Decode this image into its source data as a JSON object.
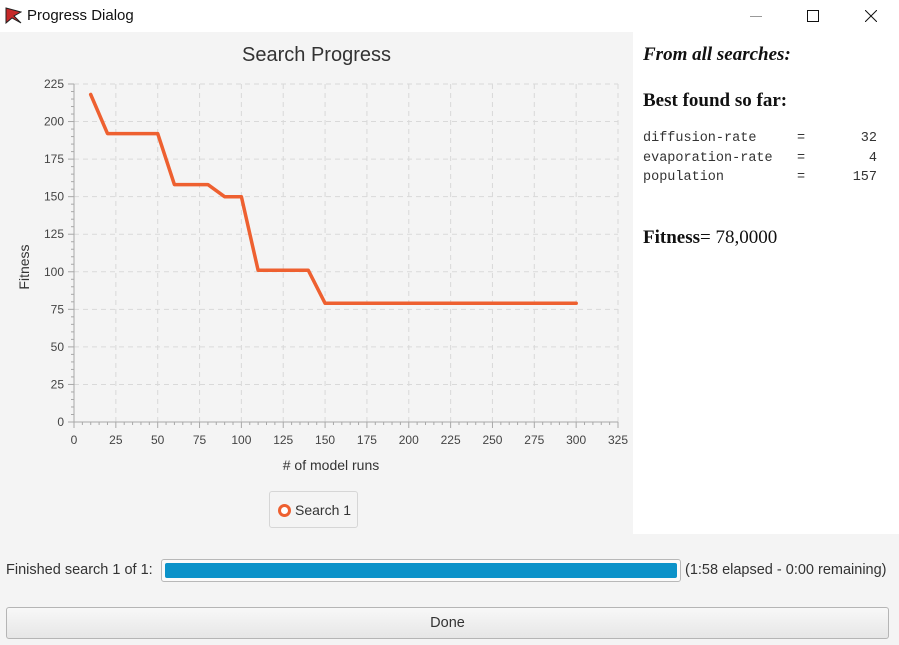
{
  "window": {
    "title": "Progress Dialog"
  },
  "chart": {
    "title": "Search Progress",
    "legend_label": "Search 1"
  },
  "chart_data": {
    "type": "line",
    "title": "Search Progress",
    "xlabel": "# of model runs",
    "ylabel": "Fitness",
    "xlim": [
      0,
      325
    ],
    "ylim": [
      0,
      225
    ],
    "xticks": [
      0,
      25,
      50,
      75,
      100,
      125,
      150,
      175,
      200,
      225,
      250,
      275,
      300,
      325
    ],
    "yticks": [
      0,
      25,
      50,
      75,
      100,
      125,
      150,
      175,
      200,
      225
    ],
    "grid": true,
    "legend_position": "bottom-center",
    "series": [
      {
        "name": "Search 1",
        "color": "#ee6030",
        "x": [
          10,
          20,
          30,
          40,
          50,
          60,
          70,
          80,
          90,
          100,
          110,
          120,
          130,
          140,
          150,
          160,
          170,
          180,
          190,
          200,
          210,
          220,
          230,
          240,
          250,
          260,
          270,
          280,
          290,
          300
        ],
        "y": [
          218,
          192,
          192,
          192,
          192,
          158,
          158,
          158,
          150,
          150,
          101,
          101,
          101,
          101,
          79,
          79,
          79,
          79,
          79,
          79,
          79,
          79,
          79,
          79,
          79,
          79,
          79,
          79,
          79,
          79
        ]
      }
    ]
  },
  "info": {
    "all_searches_heading": "From all searches:",
    "best_heading": "Best found so far:",
    "params": [
      {
        "name": "diffusion-rate",
        "eq": "=",
        "value": "32"
      },
      {
        "name": "evaporation-rate",
        "eq": "=",
        "value": "4"
      },
      {
        "name": "population",
        "eq": "=",
        "value": "157"
      }
    ],
    "fitness_label": "Fitness",
    "fitness_value": "= 78,0000"
  },
  "status": {
    "text": "Finished search 1 of 1:",
    "progress": 1.0,
    "progress_color": "#0b92c9",
    "elapsed": "(1:58 elapsed - 0:00 remaining)"
  },
  "buttons": {
    "done_label": "Done"
  }
}
